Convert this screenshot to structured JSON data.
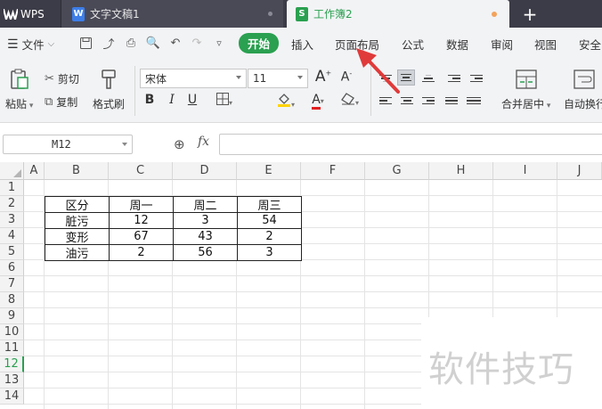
{
  "titlebar": {
    "app_name": "WPS",
    "tabs": [
      {
        "label": "文字文稿1"
      },
      {
        "label": "工作簿2"
      }
    ],
    "new_tab": "+"
  },
  "menubar": {
    "file_label": "文件",
    "items": [
      "开始",
      "插入",
      "页面布局",
      "公式",
      "数据",
      "审阅",
      "视图",
      "安全"
    ]
  },
  "ribbon": {
    "paste": "粘贴",
    "cut": "剪切",
    "copy": "复制",
    "format_painter": "格式刷",
    "font_name": "宋体",
    "font_size": "11",
    "grow_font": "A",
    "shrink_font": "A",
    "bold": "B",
    "italic": "I",
    "underline": "U",
    "merge_center": "合并居中",
    "wrap_text": "自动换行"
  },
  "formula": {
    "name_box": "M12",
    "fx": "fx",
    "value": ""
  },
  "grid": {
    "columns": [
      "A",
      "B",
      "C",
      "D",
      "E",
      "F",
      "G",
      "H",
      "I",
      "J"
    ],
    "rows": [
      "1",
      "2",
      "3",
      "4",
      "5",
      "6",
      "7",
      "8",
      "9",
      "10",
      "11",
      "12",
      "13",
      "14"
    ],
    "active_row": "12",
    "table": {
      "header": [
        "区分",
        "周一",
        "周二",
        "周三"
      ],
      "rows": [
        [
          "脏污",
          "12",
          "3",
          "54"
        ],
        [
          "变形",
          "67",
          "43",
          "2"
        ],
        [
          "油污",
          "2",
          "56",
          "3"
        ]
      ]
    }
  },
  "watermark": "软件技巧",
  "colors": {
    "accent": "#2aa050",
    "titlebar": "#3c3c48",
    "arrow": "#e03a3a"
  }
}
